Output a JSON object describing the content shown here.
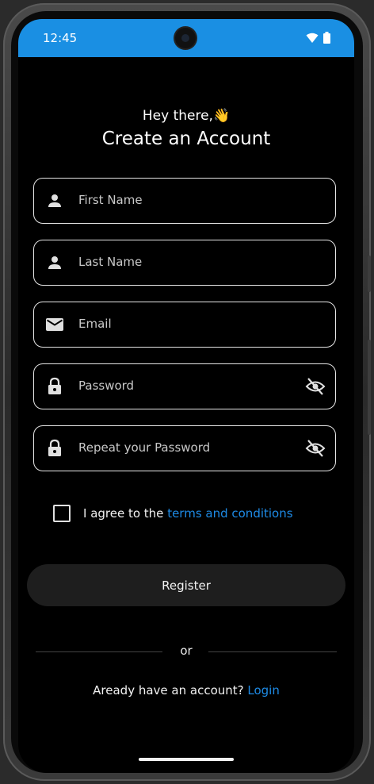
{
  "status_bar": {
    "time": "12:45",
    "icons": [
      "wifi-icon",
      "battery-icon"
    ]
  },
  "header": {
    "greeting": "Hey there,👋",
    "title": "Create an Account"
  },
  "form": {
    "first_name_placeholder": "First Name",
    "last_name_placeholder": "Last Name",
    "email_placeholder": "Email",
    "password_placeholder": "Password",
    "repeat_password_placeholder": "Repeat your Password"
  },
  "terms": {
    "prefix": "I agree to the ",
    "link": "terms and conditions",
    "checked": false
  },
  "register_label": "Register",
  "divider_text": "or",
  "login": {
    "prompt": "Aready have an account? ",
    "link": "Login"
  },
  "colors": {
    "status_bar": "#1a8fe3",
    "background": "#000000",
    "link": "#1e8be6",
    "button": "#1e1e1e"
  }
}
